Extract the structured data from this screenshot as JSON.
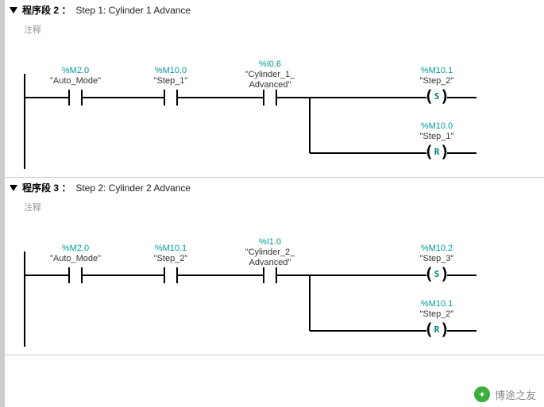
{
  "networks": [
    {
      "title": "程序段 2 ：",
      "desc": "Step 1: Cylinder 1 Advance",
      "comment": "注释",
      "contacts": [
        {
          "addr": "%M2.0",
          "sym": "\"Auto_Mode\""
        },
        {
          "addr": "%M10.0",
          "sym": "\"Step_1\""
        },
        {
          "addr": "%I0.6",
          "sym": "\"Cylinder_1_\nAdvanced\""
        }
      ],
      "coils": [
        {
          "addr": "%M10.1",
          "sym": "\"Step_2\"",
          "type": "S"
        },
        {
          "addr": "%M10.0",
          "sym": "\"Step_1\"",
          "type": "R"
        }
      ]
    },
    {
      "title": "程序段 3 ：",
      "desc": "Step 2: Cylinder 2 Advance",
      "comment": "注释",
      "contacts": [
        {
          "addr": "%M2.0",
          "sym": "\"Auto_Mode\""
        },
        {
          "addr": "%M10.1",
          "sym": "\"Step_2\""
        },
        {
          "addr": "%I1.0",
          "sym": "\"Cylinder_2_\nAdvanced\""
        }
      ],
      "coils": [
        {
          "addr": "%M10.2",
          "sym": "\"Step_3\"",
          "type": "S"
        },
        {
          "addr": "%M10.1",
          "sym": "\"Step_2\"",
          "type": "R"
        }
      ]
    }
  ],
  "watermark": "博途之友"
}
